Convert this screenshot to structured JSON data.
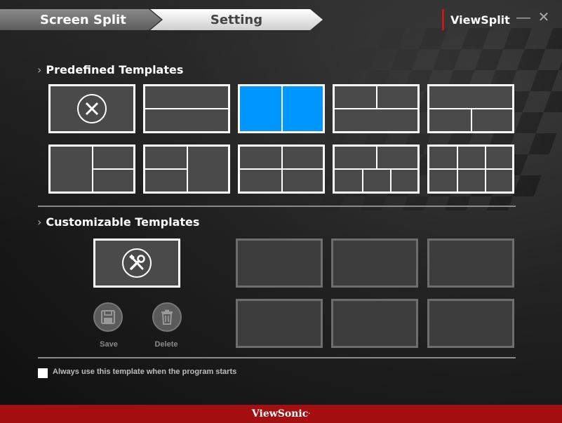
{
  "header": {
    "tabs": [
      {
        "label": "Screen Split"
      },
      {
        "label": "Setting"
      }
    ],
    "brand": "ViewSplit",
    "minimize_symbol": "—",
    "close_symbol": "✕"
  },
  "predefined": {
    "title": "Predefined Templates",
    "templates": [
      {
        "name": "none",
        "icon": "cancel-icon"
      },
      {
        "name": "two-row"
      },
      {
        "name": "two-column",
        "selected": true
      },
      {
        "name": "top-two-bottom-one"
      },
      {
        "name": "top-one-bottom-two"
      },
      {
        "name": "left-one-right-two"
      },
      {
        "name": "left-two-right-one"
      },
      {
        "name": "grid-2x2"
      },
      {
        "name": "top-two-bottom-three"
      },
      {
        "name": "grid-3x2"
      }
    ]
  },
  "customizable": {
    "title": "Customizable Templates",
    "edit_icon": "tools-icon",
    "save_label": "Save",
    "delete_label": "Delete",
    "slots": 6
  },
  "startup_option": {
    "label": "Always use this template when the program starts",
    "checked": false
  },
  "footer": {
    "brand": "ViewSonic",
    "trademark": "."
  },
  "colors": {
    "accent_blue": "#0096ff",
    "brand_red": "#a30f10",
    "tab_divider": "#c7191a"
  }
}
